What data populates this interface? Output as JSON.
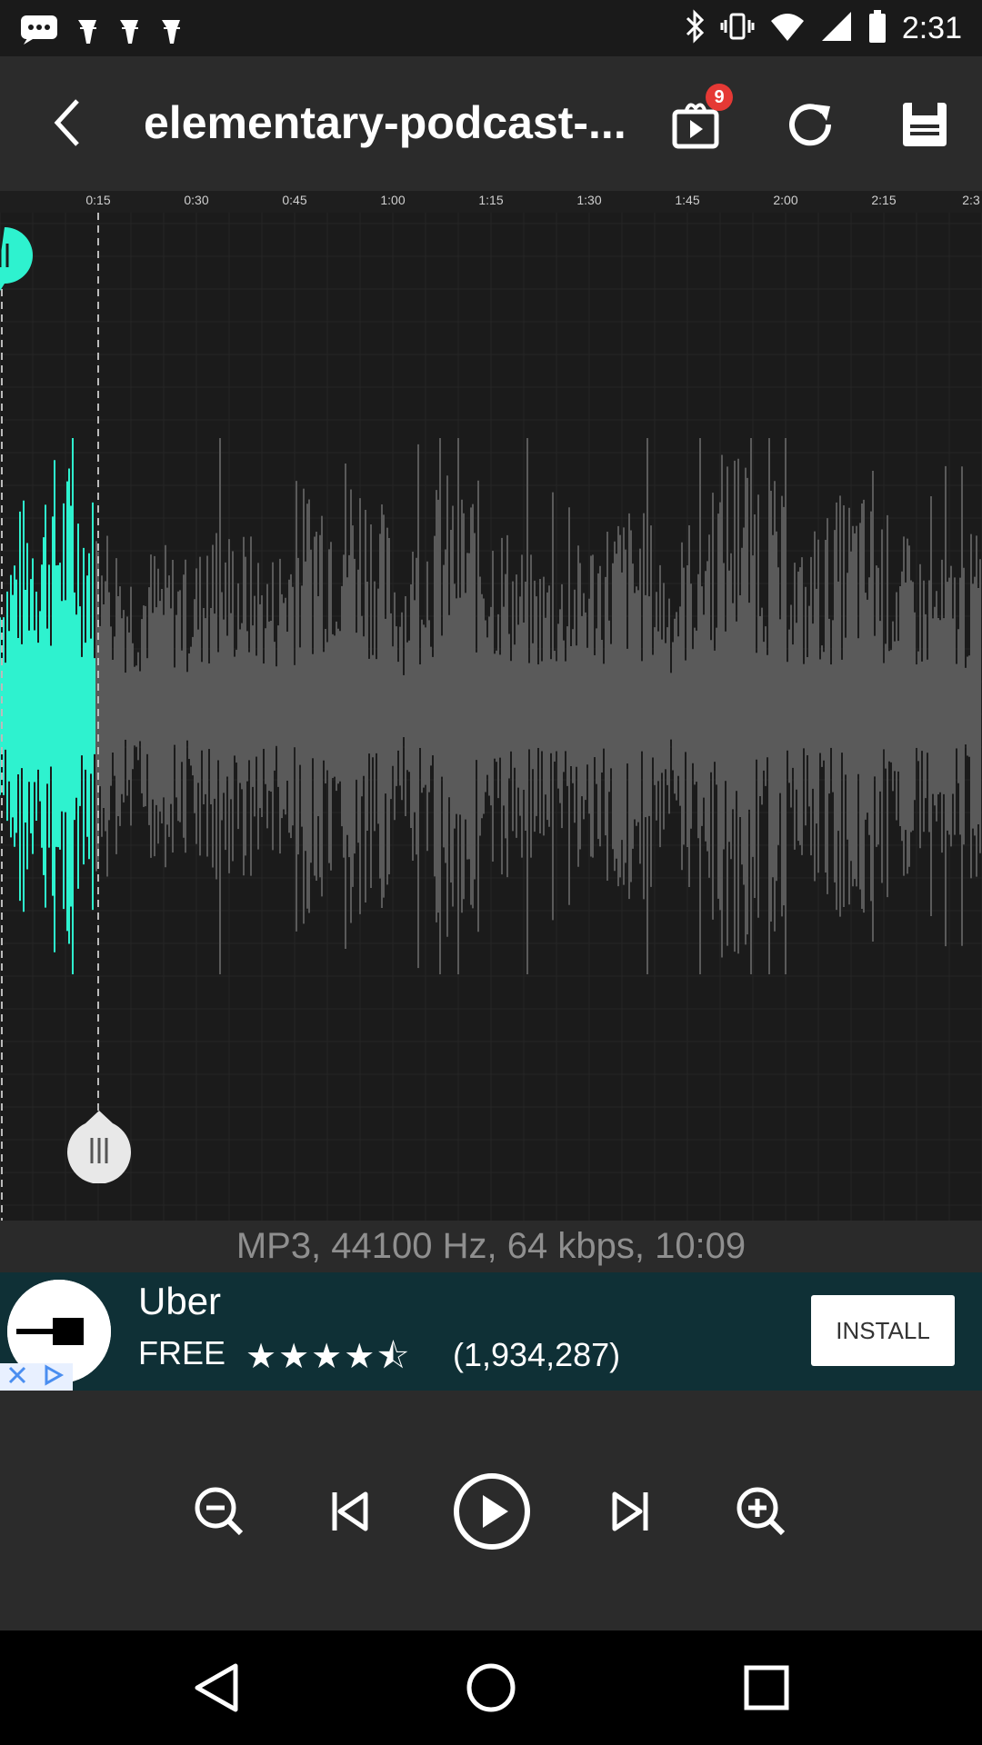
{
  "status_bar": {
    "time": "2:31",
    "icons": [
      "messages-icon",
      "notification-icon",
      "notification-icon",
      "notification-icon",
      "bluetooth-icon",
      "vibrate-icon",
      "wifi-icon",
      "signal-icon",
      "battery-icon"
    ]
  },
  "app_bar": {
    "title": "elementary-podcast-...",
    "badge_count": "9"
  },
  "timeline": {
    "labels": [
      "0:15",
      "0:30",
      "0:45",
      "1:00",
      "1:15",
      "1:30",
      "1:45",
      "2:00",
      "2:15",
      "2:3"
    ]
  },
  "file_info": "MP3, 44100 Hz, 64 kbps, 10:09",
  "ad": {
    "name": "Uber",
    "price": "FREE",
    "stars": "★★★★⯪",
    "rating_count": "(1,934,287)",
    "install_label": "INSTALL"
  },
  "colors": {
    "accent": "#2ef2cf",
    "waveform": "#5a5a5a",
    "background": "#1b1b1b",
    "bar": "#2b2b2b"
  }
}
